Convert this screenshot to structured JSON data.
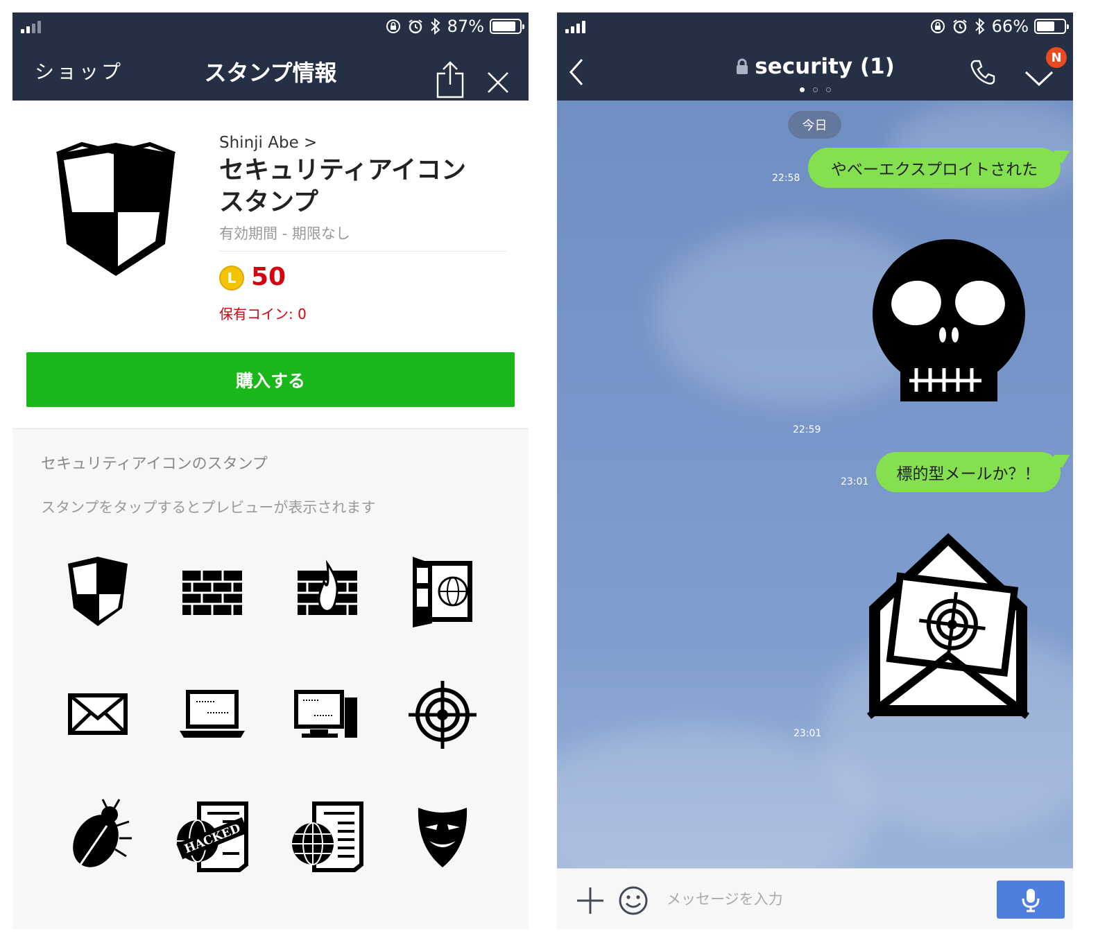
{
  "left": {
    "status": {
      "battery": "87%",
      "battery_level": 0.87
    },
    "nav": {
      "back_label": "ショップ",
      "title": "スタンプ情報"
    },
    "product": {
      "author": "Shinji Abe",
      "title_line1": "セキュリティアイコン",
      "title_line2": "スタンプ",
      "validity": "有効期間 - 期限なし",
      "coin_letter": "L",
      "price": "50",
      "owned_coins": "保有コイン: 0",
      "buy_label": "購入する"
    },
    "section": {
      "title": "セキュリティアイコンのスタンプ",
      "hint": "スタンプをタップするとプレビューが表示されます"
    },
    "stickers": [
      "shield-icon",
      "firewall-icon",
      "firewall-fire-icon",
      "open-door-globe-icon",
      "envelope-icon",
      "laptop-icon",
      "desktop-computer-icon",
      "target-icon",
      "bug-icon",
      "hacked-newspaper-icon",
      "globe-newspaper-icon",
      "mask-icon"
    ],
    "hacked_text": "HACKED"
  },
  "right": {
    "status": {
      "battery": "66%",
      "battery_level": 0.66
    },
    "nav": {
      "title": "security (1)",
      "badge": "N"
    },
    "chat": {
      "date": "今日",
      "messages": [
        {
          "type": "text",
          "text": "やべーエクスプロイトされた",
          "time": "22:58"
        },
        {
          "type": "sticker",
          "sticker": "skull-icon",
          "time": "22:59"
        },
        {
          "type": "text",
          "text": "標的型メールか？！",
          "time": "23:01"
        },
        {
          "type": "sticker",
          "sticker": "targeted-mail-icon",
          "time": "23:01"
        }
      ]
    },
    "input": {
      "placeholder": "メッセージを入力"
    }
  }
}
